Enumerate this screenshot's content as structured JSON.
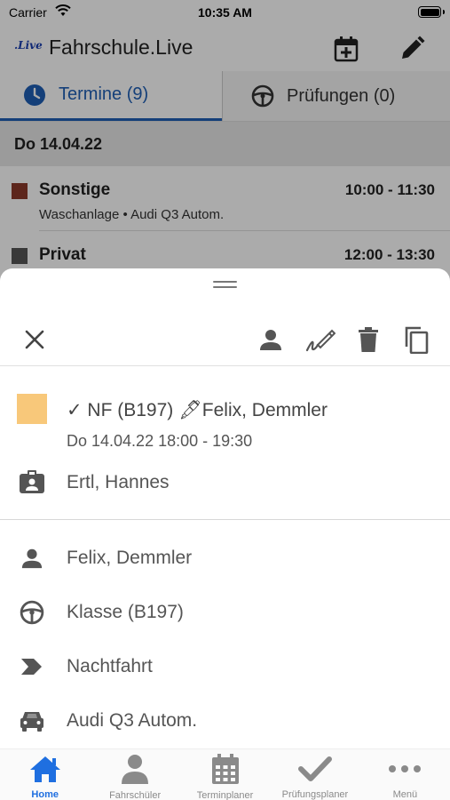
{
  "status_bar": {
    "carrier": "Carrier",
    "time": "10:35 AM"
  },
  "app": {
    "logo_text": ".Live",
    "title": "Fahrschule.Live"
  },
  "header_icons": {
    "add_event": "calendar-plus-icon",
    "edit": "pencil-icon"
  },
  "tabs": [
    {
      "label": "Termine (9)",
      "icon": "clock-icon",
      "active": true
    },
    {
      "label": "Prüfungen (0)",
      "icon": "steering-wheel-icon",
      "active": false
    }
  ],
  "date_header": "Do 14.04.22",
  "appointments": [
    {
      "category": "Sonstige",
      "time": "10:00 - 11:30",
      "subtitle": "Waschanlage • Audi Q3 Autom.",
      "color": "#8b3a2a"
    },
    {
      "category": "Privat",
      "time": "12:00 - 13:30",
      "subtitle": "",
      "color": "#555555"
    }
  ],
  "sheet": {
    "toolbar_icons": [
      "close-icon",
      "person-icon",
      "signature-icon",
      "trash-icon",
      "copy-icon"
    ],
    "summary": {
      "color": "#f8c87a",
      "title": "✓ NF (B197)  🖋Felix, Demmler",
      "datetime": "Do 14.04.22  18:00 - 19:30",
      "student": "Ertl, Hannes"
    },
    "details": {
      "instructor": "Felix, Demmler",
      "class": "Klasse (B197)",
      "type": "Nachtfahrt",
      "vehicle": "Audi Q3 Autom."
    }
  },
  "tabbar": [
    {
      "label": "Home",
      "icon": "home-icon",
      "active": true
    },
    {
      "label": "Fahrschüler",
      "icon": "person-icon",
      "active": false
    },
    {
      "label": "Terminplaner",
      "icon": "calendar-icon",
      "active": false
    },
    {
      "label": "Prüfungsplaner",
      "icon": "checkmark-icon",
      "active": false
    },
    {
      "label": "Menü",
      "icon": "more-dots-icon",
      "active": false
    }
  ],
  "colors": {
    "accent": "#1f6fe0",
    "tab_active": "#1f5fb5"
  }
}
